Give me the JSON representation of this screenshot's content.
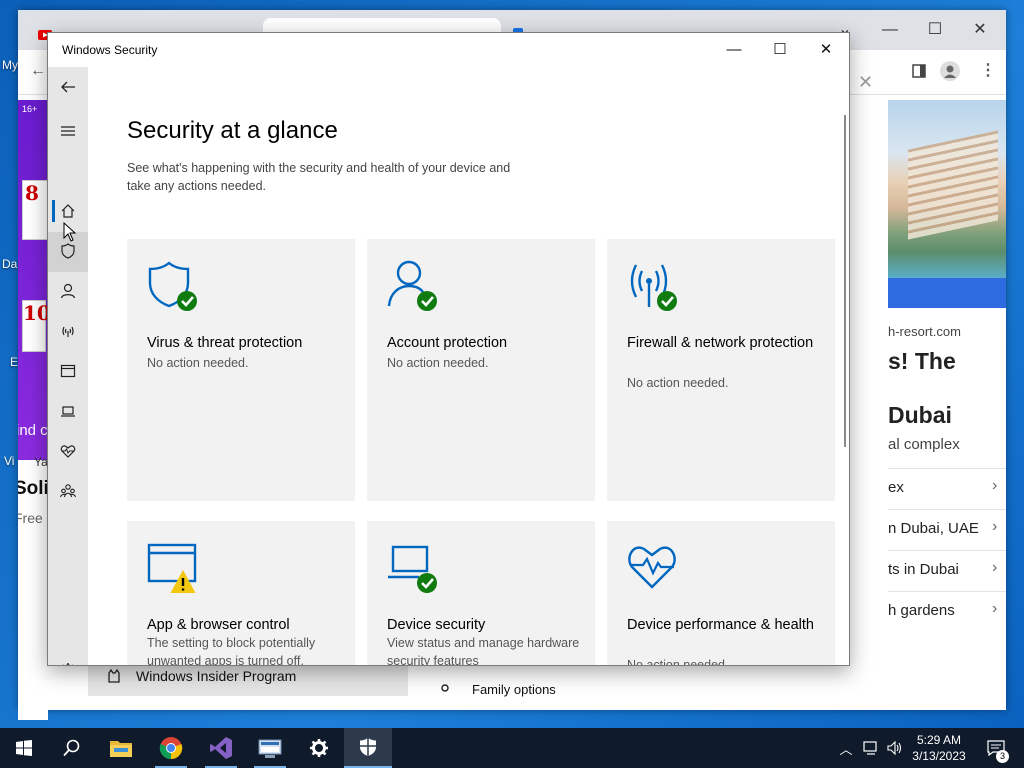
{
  "desktop": {
    "left_labels": [
      "My",
      "Da",
      "E",
      "Vi"
    ]
  },
  "browser": {
    "window_controls": {
      "chevron": "⌄",
      "minimize": "—",
      "maximize": "☐",
      "close": "✕"
    },
    "left_strip": {
      "badge": "16+",
      "card8": "8",
      "card10": "10",
      "find": "ind c",
      "ya": "Ya",
      "title": "Soli",
      "free": "Free"
    },
    "right_panel": {
      "partial_d": "d",
      "url": "h-resort.com",
      "headline1": "s! The",
      "headline2": "Dubai",
      "sub": "al complex",
      "rows": [
        {
          "label": "ex"
        },
        {
          "label": "n Dubai, UAE"
        },
        {
          "label": "ts in Dubai"
        },
        {
          "label": "h gardens"
        }
      ]
    },
    "bottom": {
      "insider": "Windows Insider Program",
      "family": "Family options"
    }
  },
  "window": {
    "title": "Windows Security",
    "controls": {
      "minimize": "—",
      "maximize": "☐",
      "close": "✕"
    }
  },
  "nav": {
    "items": [
      {
        "name": "back-arrow-icon"
      },
      {
        "name": "hamburger-menu-icon"
      },
      {
        "name": "home-icon"
      },
      {
        "name": "shield-icon"
      },
      {
        "name": "person-icon"
      },
      {
        "name": "wifi-antenna-icon"
      },
      {
        "name": "browser-window-icon"
      },
      {
        "name": "laptop-icon"
      },
      {
        "name": "heart-pulse-icon"
      },
      {
        "name": "family-icon"
      },
      {
        "name": "settings-gear-icon"
      }
    ]
  },
  "main": {
    "heading": "Security at a glance",
    "subtitle": "See what's happening with the security and health of your device and take any actions needed."
  },
  "tiles": [
    {
      "icon": "virus-shield-icon",
      "status_icon": "check",
      "title": "Virus & threat protection",
      "status": "No action needed."
    },
    {
      "icon": "account-person-icon",
      "status_icon": "check",
      "title": "Account protection",
      "status": "No action needed."
    },
    {
      "icon": "firewall-antenna-icon",
      "status_icon": "check",
      "title": "Firewall & network protection",
      "status": "No action needed."
    },
    {
      "icon": "app-browser-icon",
      "status_icon": "warning",
      "title": "App & browser control",
      "status": "The setting to block potentially unwanted apps is turned off."
    },
    {
      "icon": "device-security-laptop-icon",
      "status_icon": "check",
      "title": "Device security",
      "status": "View status and manage hardware security features"
    },
    {
      "icon": "device-performance-heart-icon",
      "status_icon": "none",
      "title": "Device performance & health",
      "status": "No action needed."
    }
  ],
  "colors": {
    "accent": "#0067c0",
    "ok_green": "#107c10",
    "warning_yellow": "#f2c811",
    "nav_bg": "#e6e6e6",
    "tile_bg": "#f2f2f2",
    "taskbar": "#0f1a2a"
  },
  "taskbar": {
    "apps": [
      "start-windows-icon",
      "search-icon",
      "file-explorer-icon",
      "chrome-icon",
      "visual-studio-icon",
      "network-tool-icon",
      "settings-icon",
      "windows-security-icon"
    ],
    "time": "5:29 AM",
    "date": "3/13/2023",
    "notification_count": "3"
  }
}
